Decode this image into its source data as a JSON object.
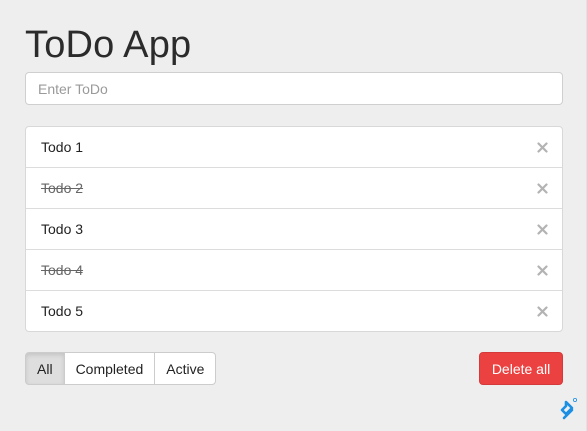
{
  "app": {
    "title": "ToDo App"
  },
  "input": {
    "placeholder": "Enter ToDo",
    "value": ""
  },
  "todos": [
    {
      "label": "Todo 1",
      "completed": false
    },
    {
      "label": "Todo 2",
      "completed": true
    },
    {
      "label": "Todo 3",
      "completed": false
    },
    {
      "label": "Todo 4",
      "completed": true
    },
    {
      "label": "Todo 5",
      "completed": false
    }
  ],
  "remove_icon": "close-icon",
  "filters": {
    "all_label": "All",
    "completed_label": "Completed",
    "active_label": "Active",
    "selected": "All"
  },
  "actions": {
    "delete_all_label": "Delete all"
  },
  "colors": {
    "background": "#eeeeee",
    "danger": "#ec4141",
    "brand": "#1a8fe3"
  },
  "brand_icon": "toptal-logo-icon"
}
